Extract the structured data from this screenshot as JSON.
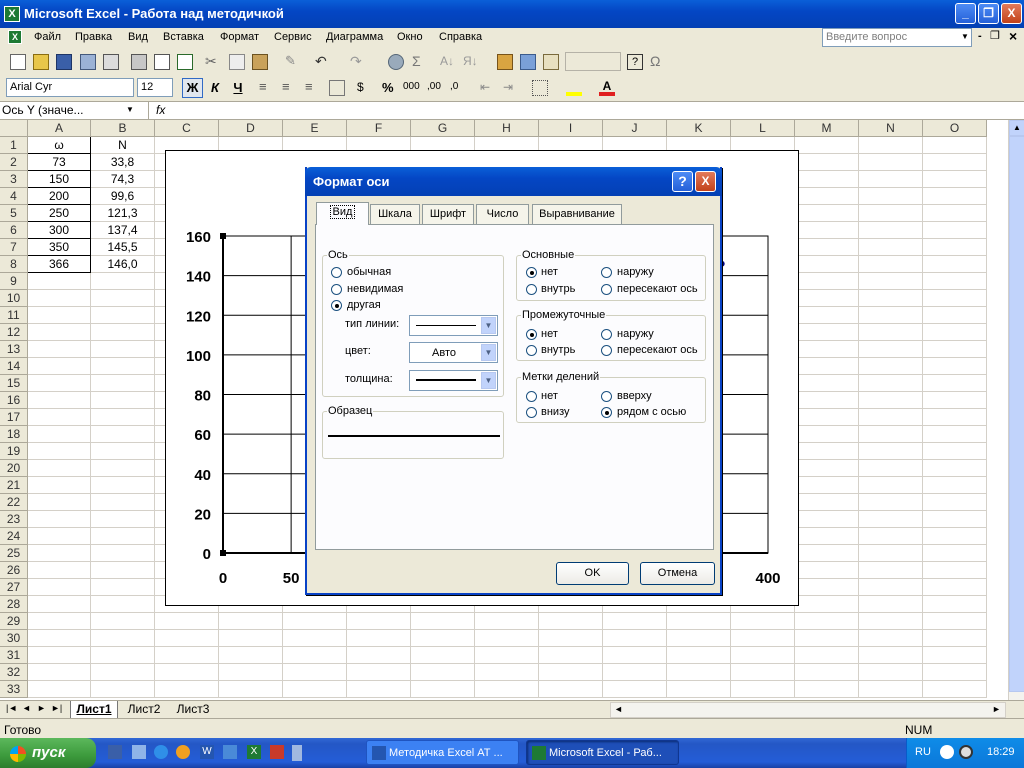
{
  "window": {
    "title": "Microsoft Excel - Работа над методичкой",
    "min": "_",
    "restore": "❐",
    "close": "X"
  },
  "menu": {
    "items": [
      "Файл",
      "Правка",
      "Вид",
      "Вставка",
      "Формат",
      "Сервис",
      "Диаграмма",
      "Окно",
      "Справка"
    ],
    "help_placeholder": "Введите вопрос",
    "doc_ctrls": [
      "-",
      "❐",
      "×"
    ]
  },
  "format_toolbar": {
    "font": "Arial Cyr",
    "size": "12",
    "bold": "Ж",
    "italic": "К",
    "underline": "Ч",
    "percent": "%",
    "thousands": "000"
  },
  "formula_bar": {
    "name_box": "Ось Y (значе...",
    "fx": "fx"
  },
  "columns": [
    "A",
    "B",
    "C",
    "D",
    "E",
    "F",
    "G",
    "H",
    "I",
    "J",
    "K",
    "L",
    "M",
    "N",
    "O"
  ],
  "rows": [
    "1",
    "2",
    "3",
    "4",
    "5",
    "6",
    "7",
    "8",
    "9",
    "10",
    "11",
    "12",
    "13",
    "14",
    "15",
    "16",
    "17",
    "18",
    "19",
    "20",
    "21",
    "22",
    "23",
    "24",
    "25",
    "26",
    "27",
    "28",
    "29",
    "30",
    "31",
    "32",
    "33"
  ],
  "sheet": {
    "colA": [
      "ω",
      "73",
      "150",
      "200",
      "250",
      "300",
      "350",
      "366"
    ],
    "colB": [
      "N",
      "33,8",
      "74,3",
      "99,6",
      "121,3",
      "137,4",
      "145,5",
      "146,0"
    ]
  },
  "chart": {
    "yticks": [
      "160",
      "140",
      "120",
      "100",
      "80",
      "60",
      "40",
      "20",
      "0"
    ],
    "xticks": [
      "0",
      "50",
      "400"
    ]
  },
  "chart_data": {
    "type": "scatter",
    "x": [
      73,
      150,
      200,
      250,
      300,
      350,
      366
    ],
    "y": [
      33.8,
      74.3,
      99.6,
      121.3,
      137.4,
      145.5,
      146.0
    ],
    "xlim": [
      0,
      400
    ],
    "ylim": [
      0,
      160
    ],
    "yticks": [
      0,
      20,
      40,
      60,
      80,
      100,
      120,
      140,
      160
    ],
    "grid": true
  },
  "dialog": {
    "title": "Формат оси",
    "help": "?",
    "close": "X",
    "tabs": [
      "Вид",
      "Шкала",
      "Шрифт",
      "Число",
      "Выравнивание"
    ],
    "axis": {
      "legend": "Ось",
      "options": [
        "обычная",
        "невидимая",
        "другая"
      ],
      "line_type_label": "тип линии:",
      "color_label": "цвет:",
      "color_value": "Авто",
      "weight_label": "толщина:"
    },
    "sample": {
      "legend": "Образец"
    },
    "major": {
      "legend": "Основные",
      "options": [
        "нет",
        "наружу",
        "внутрь",
        "пересекают ось"
      ]
    },
    "minor": {
      "legend": "Промежуточные",
      "options": [
        "нет",
        "наружу",
        "внутрь",
        "пересекают ось"
      ]
    },
    "ticklabels": {
      "legend": "Метки делений",
      "options": [
        "нет",
        "вверху",
        "внизу",
        "рядом с осью"
      ]
    },
    "ok": "OK",
    "cancel": "Отмена"
  },
  "sheet_tabs": [
    "Лист1",
    "Лист2",
    "Лист3"
  ],
  "status": {
    "left": "Готово",
    "num": "NUM"
  },
  "taskbar": {
    "start": "пуск",
    "tasks": [
      "Методичка Excel АТ ...",
      "Microsoft Excel - Раб..."
    ],
    "lang": "RU",
    "time": "18:29"
  }
}
